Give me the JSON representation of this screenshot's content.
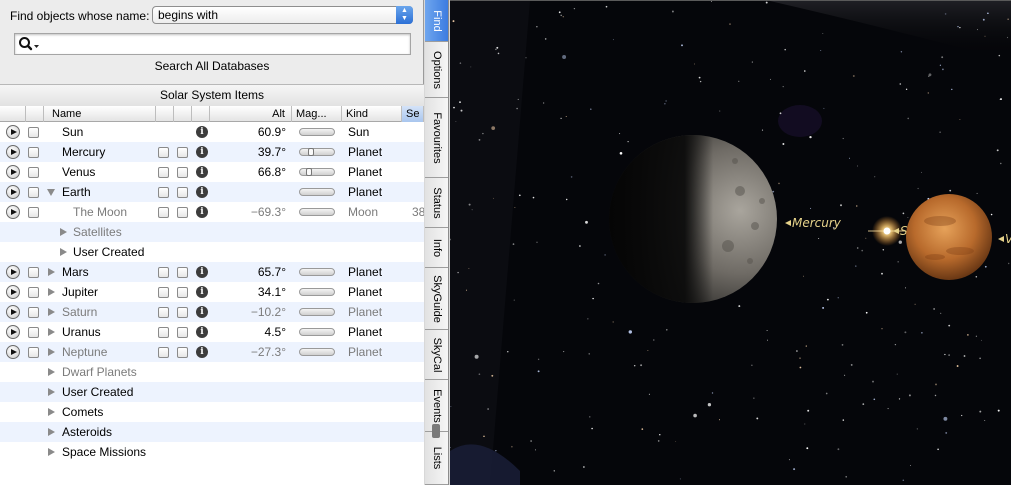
{
  "find": {
    "label": "Find objects whose name:",
    "match_mode": "begins with",
    "search_value": "",
    "search_all_label": "Search All Databases"
  },
  "list_title": "Solar System Items",
  "columns": [
    "",
    "",
    "Name",
    "",
    "",
    "",
    "Alt",
    "Mag...",
    "Kind",
    "Se"
  ],
  "rows": [
    {
      "name": "Sun",
      "alt": "60.9°",
      "kind": "Sun",
      "extra": "",
      "dim": false,
      "indent": 0,
      "play": true,
      "check": true,
      "chk2": false,
      "info": true,
      "slider": true,
      "knob": 0,
      "expander": "none"
    },
    {
      "name": "Mercury",
      "alt": "39.7°",
      "kind": "Planet",
      "extra": "",
      "dim": false,
      "indent": 0,
      "play": true,
      "check": true,
      "chk2": true,
      "info": true,
      "slider": true,
      "knob": 8,
      "expander": "none"
    },
    {
      "name": "Venus",
      "alt": "66.8°",
      "kind": "Planet",
      "extra": "",
      "dim": false,
      "indent": 0,
      "play": true,
      "check": true,
      "chk2": true,
      "info": true,
      "slider": true,
      "knob": 6,
      "expander": "none"
    },
    {
      "name": "Earth",
      "alt": "",
      "kind": "Planet",
      "extra": "",
      "dim": false,
      "indent": 0,
      "play": true,
      "check": true,
      "chk2": true,
      "info": true,
      "slider": true,
      "knob": 0,
      "expander": "down"
    },
    {
      "name": "The Moon",
      "alt": "−69.3°",
      "kind": "Moon",
      "extra": "38",
      "dim": true,
      "indent": 1,
      "play": true,
      "check": true,
      "chk2": true,
      "info": true,
      "slider": true,
      "knob": 0,
      "expander": "none"
    },
    {
      "name": "Satellites",
      "alt": "",
      "kind": "",
      "extra": "",
      "dim": true,
      "indent": 1,
      "play": false,
      "check": false,
      "chk2": false,
      "info": false,
      "slider": false,
      "knob": 0,
      "expander": "right"
    },
    {
      "name": "User Created",
      "alt": "",
      "kind": "",
      "extra": "",
      "dim": false,
      "indent": 1,
      "play": false,
      "check": false,
      "chk2": false,
      "info": false,
      "slider": false,
      "knob": 0,
      "expander": "right"
    },
    {
      "name": "Mars",
      "alt": "65.7°",
      "kind": "Planet",
      "extra": "",
      "dim": false,
      "indent": 0,
      "play": true,
      "check": true,
      "chk2": true,
      "info": true,
      "slider": true,
      "knob": 0,
      "expander": "right"
    },
    {
      "name": "Jupiter",
      "alt": "34.1°",
      "kind": "Planet",
      "extra": "",
      "dim": false,
      "indent": 0,
      "play": true,
      "check": true,
      "chk2": true,
      "info": true,
      "slider": true,
      "knob": 0,
      "expander": "right"
    },
    {
      "name": "Saturn",
      "alt": "−10.2°",
      "kind": "Planet",
      "extra": "",
      "dim": true,
      "indent": 0,
      "play": true,
      "check": true,
      "chk2": true,
      "info": true,
      "slider": true,
      "knob": 0,
      "expander": "right"
    },
    {
      "name": "Uranus",
      "alt": "4.5°",
      "kind": "Planet",
      "extra": "",
      "dim": false,
      "indent": 0,
      "play": true,
      "check": true,
      "chk2": true,
      "info": true,
      "slider": true,
      "knob": 0,
      "expander": "right"
    },
    {
      "name": "Neptune",
      "alt": "−27.3°",
      "kind": "Planet",
      "extra": "",
      "dim": true,
      "indent": 0,
      "play": true,
      "check": true,
      "chk2": true,
      "info": true,
      "slider": true,
      "knob": 0,
      "expander": "right"
    },
    {
      "name": "Dwarf Planets",
      "alt": "",
      "kind": "",
      "extra": "",
      "dim": true,
      "indent": 0,
      "play": false,
      "check": false,
      "chk2": false,
      "info": false,
      "slider": false,
      "knob": 0,
      "expander": "group"
    },
    {
      "name": "User Created",
      "alt": "",
      "kind": "",
      "extra": "",
      "dim": false,
      "indent": 0,
      "play": false,
      "check": false,
      "chk2": false,
      "info": false,
      "slider": false,
      "knob": 0,
      "expander": "group"
    },
    {
      "name": "Comets",
      "alt": "",
      "kind": "",
      "extra": "",
      "dim": false,
      "indent": 0,
      "play": false,
      "check": false,
      "chk2": false,
      "info": false,
      "slider": false,
      "knob": 0,
      "expander": "group"
    },
    {
      "name": "Asteroids",
      "alt": "",
      "kind": "",
      "extra": "",
      "dim": false,
      "indent": 0,
      "play": false,
      "check": false,
      "chk2": false,
      "info": false,
      "slider": false,
      "knob": 0,
      "expander": "group"
    },
    {
      "name": "Space Missions",
      "alt": "",
      "kind": "",
      "extra": "",
      "dim": false,
      "indent": 0,
      "play": false,
      "check": false,
      "chk2": false,
      "info": false,
      "slider": false,
      "knob": 0,
      "expander": "group"
    }
  ],
  "tabs": [
    {
      "label": "Find",
      "active": true
    },
    {
      "label": "Options",
      "active": false
    },
    {
      "label": "Favourites",
      "active": false
    },
    {
      "label": "Status",
      "active": false
    },
    {
      "label": "Info",
      "active": false
    },
    {
      "label": "SkyGuide",
      "active": false
    },
    {
      "label": "SkyCal",
      "active": false
    },
    {
      "label": "Events",
      "active": false
    },
    {
      "label": "Lists",
      "active": false
    }
  ],
  "sky": {
    "labels": {
      "mercury": "Mercury",
      "sun": "Sun",
      "venus_partial": "V"
    },
    "label_color": "#e6d28a"
  }
}
